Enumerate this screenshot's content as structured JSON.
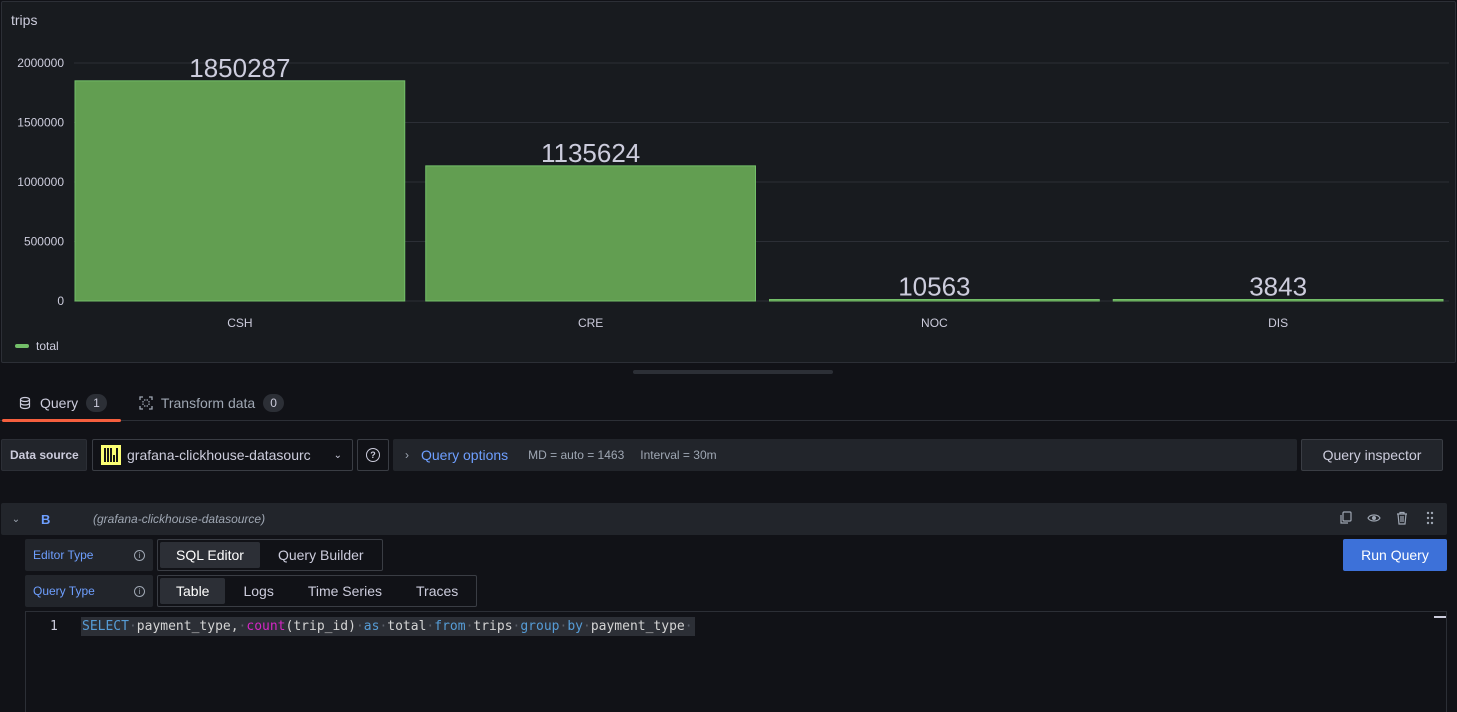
{
  "panel": {
    "title": "trips"
  },
  "chart_data": {
    "type": "bar",
    "title": "trips",
    "categories": [
      "CSH",
      "CRE",
      "NOC",
      "DIS"
    ],
    "series": [
      {
        "name": "total",
        "values": [
          1850287,
          1135624,
          10563,
          3843
        ],
        "color": "#73bf69"
      }
    ],
    "y_ticks": [
      0,
      500000,
      1000000,
      1500000,
      2000000
    ],
    "ylim": [
      0,
      2000000
    ],
    "grid": true,
    "legend": "bottom-left"
  },
  "tabs": [
    {
      "label": "Query",
      "count": "1"
    },
    {
      "label": "Transform data",
      "count": "0"
    }
  ],
  "datasource": {
    "label": "Data source",
    "selected": "grafana-clickhouse-datasourc",
    "query_options_title": "Query options",
    "md": "MD = auto = 1463",
    "interval": "Interval = 30m",
    "inspector_label": "Query inspector"
  },
  "query_row": {
    "ref_id": "B",
    "datasource_name": "(grafana-clickhouse-datasource)",
    "editor_type_label": "Editor Type",
    "editor_types": [
      "SQL Editor",
      "Query Builder"
    ],
    "query_type_label": "Query Type",
    "query_types": [
      "Table",
      "Logs",
      "Time Series",
      "Traces"
    ],
    "run_label": "Run Query",
    "line_number": "1"
  },
  "colors": {
    "accent": "#6e9fff",
    "bar": "#73bf69",
    "tab_underline": "#f55f3e",
    "run_button": "#3d71d9"
  }
}
